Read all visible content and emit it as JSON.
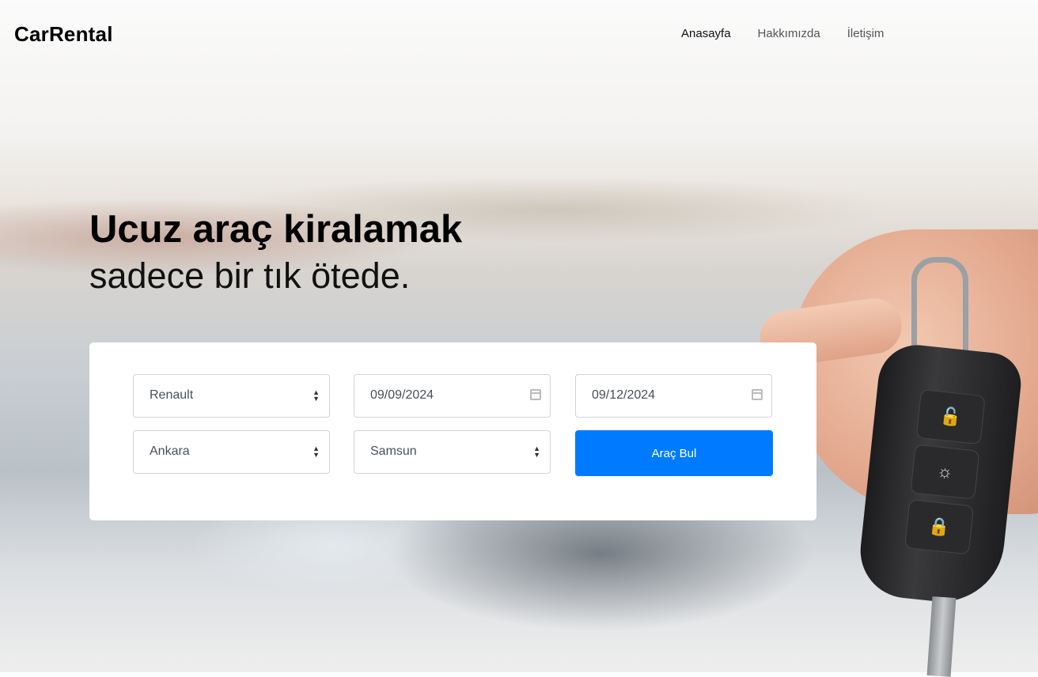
{
  "navbar": {
    "brand": "CarRental",
    "links": [
      "Anasayfa",
      "Hakkımızda",
      "İletişim"
    ],
    "active_link": "Anasayfa"
  },
  "hero": {
    "title": "Ucuz araç kiralamak",
    "subtitle": "sadece bir tık ötede."
  },
  "search": {
    "brand_select": "Renault",
    "pickup_date": "09/09/2024",
    "return_date": "09/12/2024",
    "pickup_city": "Ankara",
    "return_city": "Samsun",
    "button_label": "Araç Bul"
  },
  "colors": {
    "accent": "#007bff"
  },
  "icons": {
    "select": "up-down-caret-icon",
    "date": "calendar-icon"
  }
}
